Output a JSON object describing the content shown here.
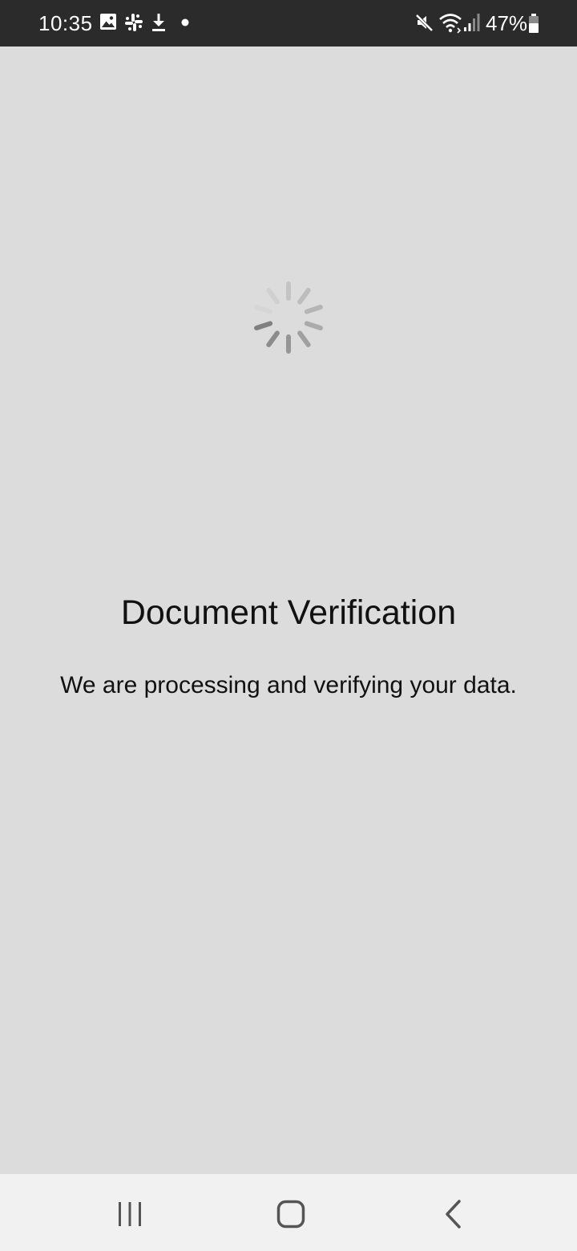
{
  "status_bar": {
    "time": "10:35",
    "battery": "47%",
    "left_icons": [
      "image-icon",
      "slack-icon",
      "download-icon",
      "dot-icon"
    ],
    "right_icons": [
      "mute-icon",
      "wifi-icon",
      "signal-icon",
      "battery-icon"
    ]
  },
  "main": {
    "title": "Document Verification",
    "subtitle": "We are processing and verifying your data.",
    "loading_indicator": "spinner-icon"
  },
  "nav_bar": {
    "buttons": [
      "recent-apps-icon",
      "home-icon",
      "back-icon"
    ]
  },
  "colors": {
    "status_bar_bg": "#2b2b2b",
    "content_bg": "#dcdcdc",
    "nav_bar_bg": "#f1f1f1",
    "text": "#111111"
  }
}
